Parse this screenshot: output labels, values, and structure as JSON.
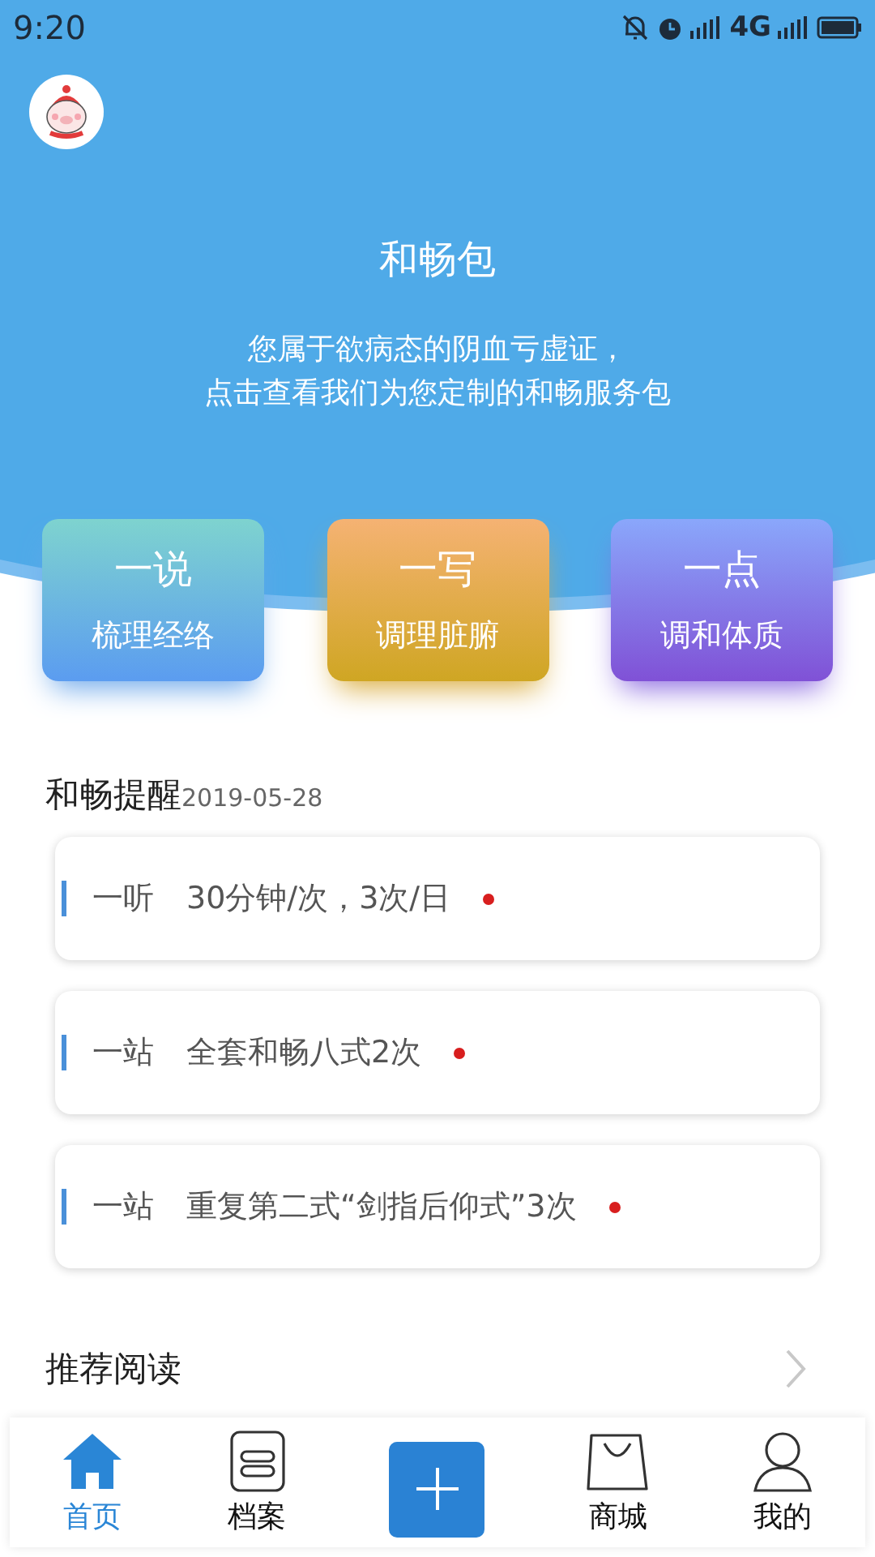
{
  "status_bar": {
    "time": "9:20",
    "network": "4G"
  },
  "header": {
    "title": "和畅包",
    "lines": [
      "您属于欲病态的阴血亏虚证，",
      "点击查看我们为您定制的和畅服务包"
    ]
  },
  "services": [
    {
      "title": "一说",
      "subtitle": "梳理经络",
      "color": "#6aa6ea"
    },
    {
      "title": "一写",
      "subtitle": "调理脏腑",
      "color": "#d9aa3a"
    },
    {
      "title": "一点",
      "subtitle": "调和体质",
      "color": "#8a68e0"
    }
  ],
  "reminders": {
    "title": "和畅提醒",
    "date": "2019-05-28",
    "items": [
      {
        "label": "一听",
        "text": "30分钟/次，3次/日",
        "unread": true
      },
      {
        "label": "一站",
        "text": "全套和畅八式2次",
        "unread": true
      },
      {
        "label": "一站",
        "text": "重复第二式“剑指后仰式”3次",
        "unread": true
      }
    ]
  },
  "reading": {
    "title": "推荐阅读"
  },
  "nav": [
    {
      "kind": "home",
      "label": "首页",
      "selected": true
    },
    {
      "kind": "file",
      "label": "档案",
      "selected": false
    },
    {
      "kind": "add",
      "selected": false
    },
    {
      "kind": "shop",
      "label": "商城",
      "selected": false
    },
    {
      "kind": "user",
      "label": "我的",
      "selected": false
    }
  ]
}
